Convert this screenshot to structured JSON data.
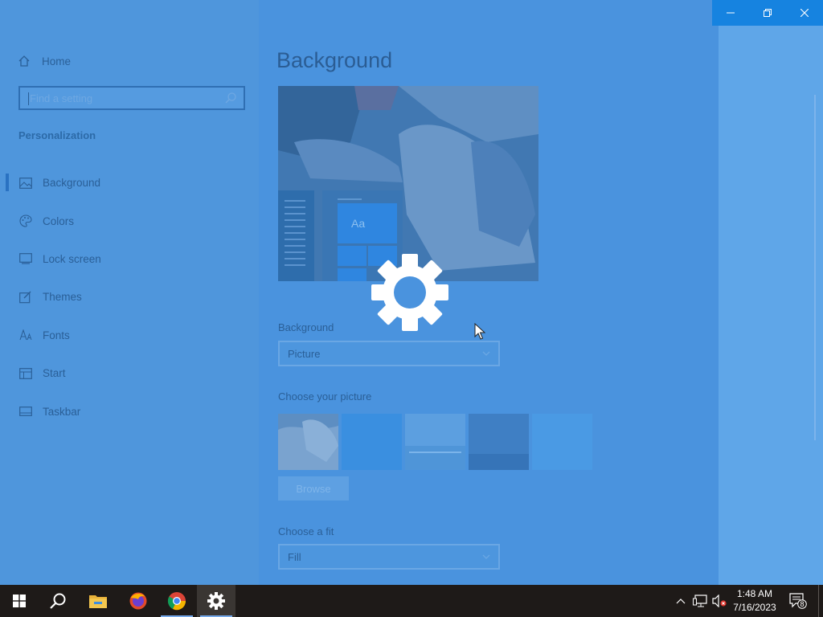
{
  "window": {
    "controls": [
      "minimize",
      "restore",
      "close"
    ]
  },
  "sidebar": {
    "home_label": "Home",
    "search_placeholder": "Find a setting",
    "section_title": "Personalization",
    "items": [
      {
        "label": "Background",
        "icon": "image-icon",
        "active": true
      },
      {
        "label": "Colors",
        "icon": "palette-icon",
        "active": false
      },
      {
        "label": "Lock screen",
        "icon": "lock-screen-icon",
        "active": false
      },
      {
        "label": "Themes",
        "icon": "themes-icon",
        "active": false
      },
      {
        "label": "Fonts",
        "icon": "fonts-icon",
        "active": false
      },
      {
        "label": "Start",
        "icon": "start-icon",
        "active": false
      },
      {
        "label": "Taskbar",
        "icon": "taskbar-icon",
        "active": false
      }
    ]
  },
  "main": {
    "title": "Background",
    "preview": {
      "sample_text": "Aa"
    },
    "background_label": "Background",
    "background_value": "Picture",
    "choose_picture_label": "Choose your picture",
    "browse_label": "Browse",
    "choose_fit_label": "Choose a fit",
    "fit_value": "Fill"
  },
  "taskbar": {
    "pinned": [
      {
        "name": "start",
        "icon": "windows-logo-icon"
      },
      {
        "name": "search",
        "icon": "search-icon"
      },
      {
        "name": "file-explorer",
        "icon": "folder-icon"
      },
      {
        "name": "firefox",
        "icon": "firefox-icon"
      },
      {
        "name": "chrome",
        "icon": "chrome-icon"
      },
      {
        "name": "settings",
        "icon": "gear-icon"
      }
    ],
    "time": "1:48 AM",
    "date": "7/16/2023",
    "notification_count": "8"
  },
  "colors": {
    "overlay_blue": "#4a93de",
    "accent": "#1683e0",
    "taskbar": "#1e1a18"
  }
}
